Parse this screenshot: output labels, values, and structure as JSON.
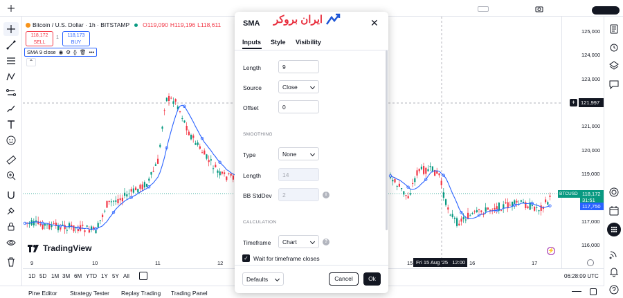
{
  "chart": {
    "symbol_title": "Bitcoin / U.S. Dollar · 1h · BITSTAMP",
    "ohl": {
      "open": "O119,090",
      "high": "H119,196",
      "low": "L118,611"
    },
    "sell": {
      "price": "118,172",
      "label": "SELL"
    },
    "spread": "1",
    "buy": {
      "price": "118,173",
      "label": "BUY"
    },
    "indicator_label": "SMA 9 close",
    "price_labels": [
      "125,000",
      "124,000",
      "123,000",
      "122,000",
      "121,000",
      "120,000",
      "119,000",
      "118,000",
      "117,000",
      "116,000"
    ],
    "crosshair_price": "121,997",
    "ticker_badge": "BTCUSD",
    "last_price": "118,172",
    "countdown": "31:51",
    "sma_price": "117,750",
    "time_labels": [
      "9",
      "10",
      "11",
      "12",
      "15",
      "16",
      "17"
    ],
    "crosshair_time": "Fri 15 Aug '25   12:00",
    "watermark": "TradingView",
    "colors": {
      "up": "#089981",
      "down": "#f23645",
      "sma": "#2962ff"
    }
  },
  "timeframes": [
    "1D",
    "5D",
    "1M",
    "3M",
    "6M",
    "YTD",
    "1Y",
    "5Y",
    "All"
  ],
  "clock": "06:28:09 UTC",
  "footer_tabs": [
    "Pine Editor",
    "Strategy Tester",
    "Replay Trading",
    "Trading Panel"
  ],
  "logo_text": "ایران بروکر",
  "dialog": {
    "title": "SMA",
    "tabs": [
      "Inputs",
      "Style",
      "Visibility"
    ],
    "length_label": "Length",
    "length_value": "9",
    "source_label": "Source",
    "source_value": "Close",
    "offset_label": "Offset",
    "offset_value": "0",
    "smoothing_section": "SMOOTHING",
    "type_label": "Type",
    "type_value": "None",
    "smoothing_length_label": "Length",
    "smoothing_length_value": "14",
    "bb_label": "BB StdDev",
    "bb_value": "2",
    "calculation_section": "CALCULATION",
    "timeframe_label": "Timeframe",
    "timeframe_value": "Chart",
    "wait_label": "Wait for timeframe closes",
    "defaults_label": "Defaults",
    "cancel_label": "Cancel",
    "ok_label": "Ok"
  }
}
